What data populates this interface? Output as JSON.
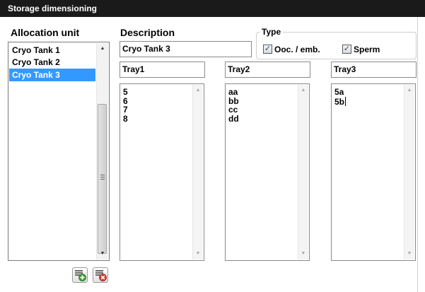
{
  "window": {
    "title": "Storage dimensioning"
  },
  "allocation": {
    "heading": "Allocation unit",
    "items": [
      "Cryo Tank 1",
      "Cryo Tank 2",
      "Cryo Tank 3"
    ],
    "selected_index": 2
  },
  "description": {
    "label": "Description",
    "value": "Cryo Tank 3"
  },
  "type": {
    "legend": "Type",
    "options": [
      {
        "label": "Ooc. / emb.",
        "checked": true
      },
      {
        "label": "Sperm",
        "checked": true
      }
    ]
  },
  "trays": [
    {
      "name": "Tray1",
      "entries": [
        "5",
        "6",
        "7",
        "8"
      ]
    },
    {
      "name": "Tray2",
      "entries": [
        "aa",
        "bb",
        "cc",
        "dd"
      ]
    },
    {
      "name": "Tray3",
      "entries": [
        "5a",
        "5b"
      ]
    }
  ],
  "icons": {
    "add": "add-item-icon",
    "delete": "delete-item-icon",
    "check": "checkmark-icon",
    "scroll_up": "scroll-up-arrow-icon",
    "scroll_down": "scroll-down-arrow-icon"
  },
  "colors": {
    "titlebar": "#1a1a1a",
    "selection": "#3399ff",
    "add_green": "#3aa02f",
    "delete_red": "#d43a30"
  }
}
